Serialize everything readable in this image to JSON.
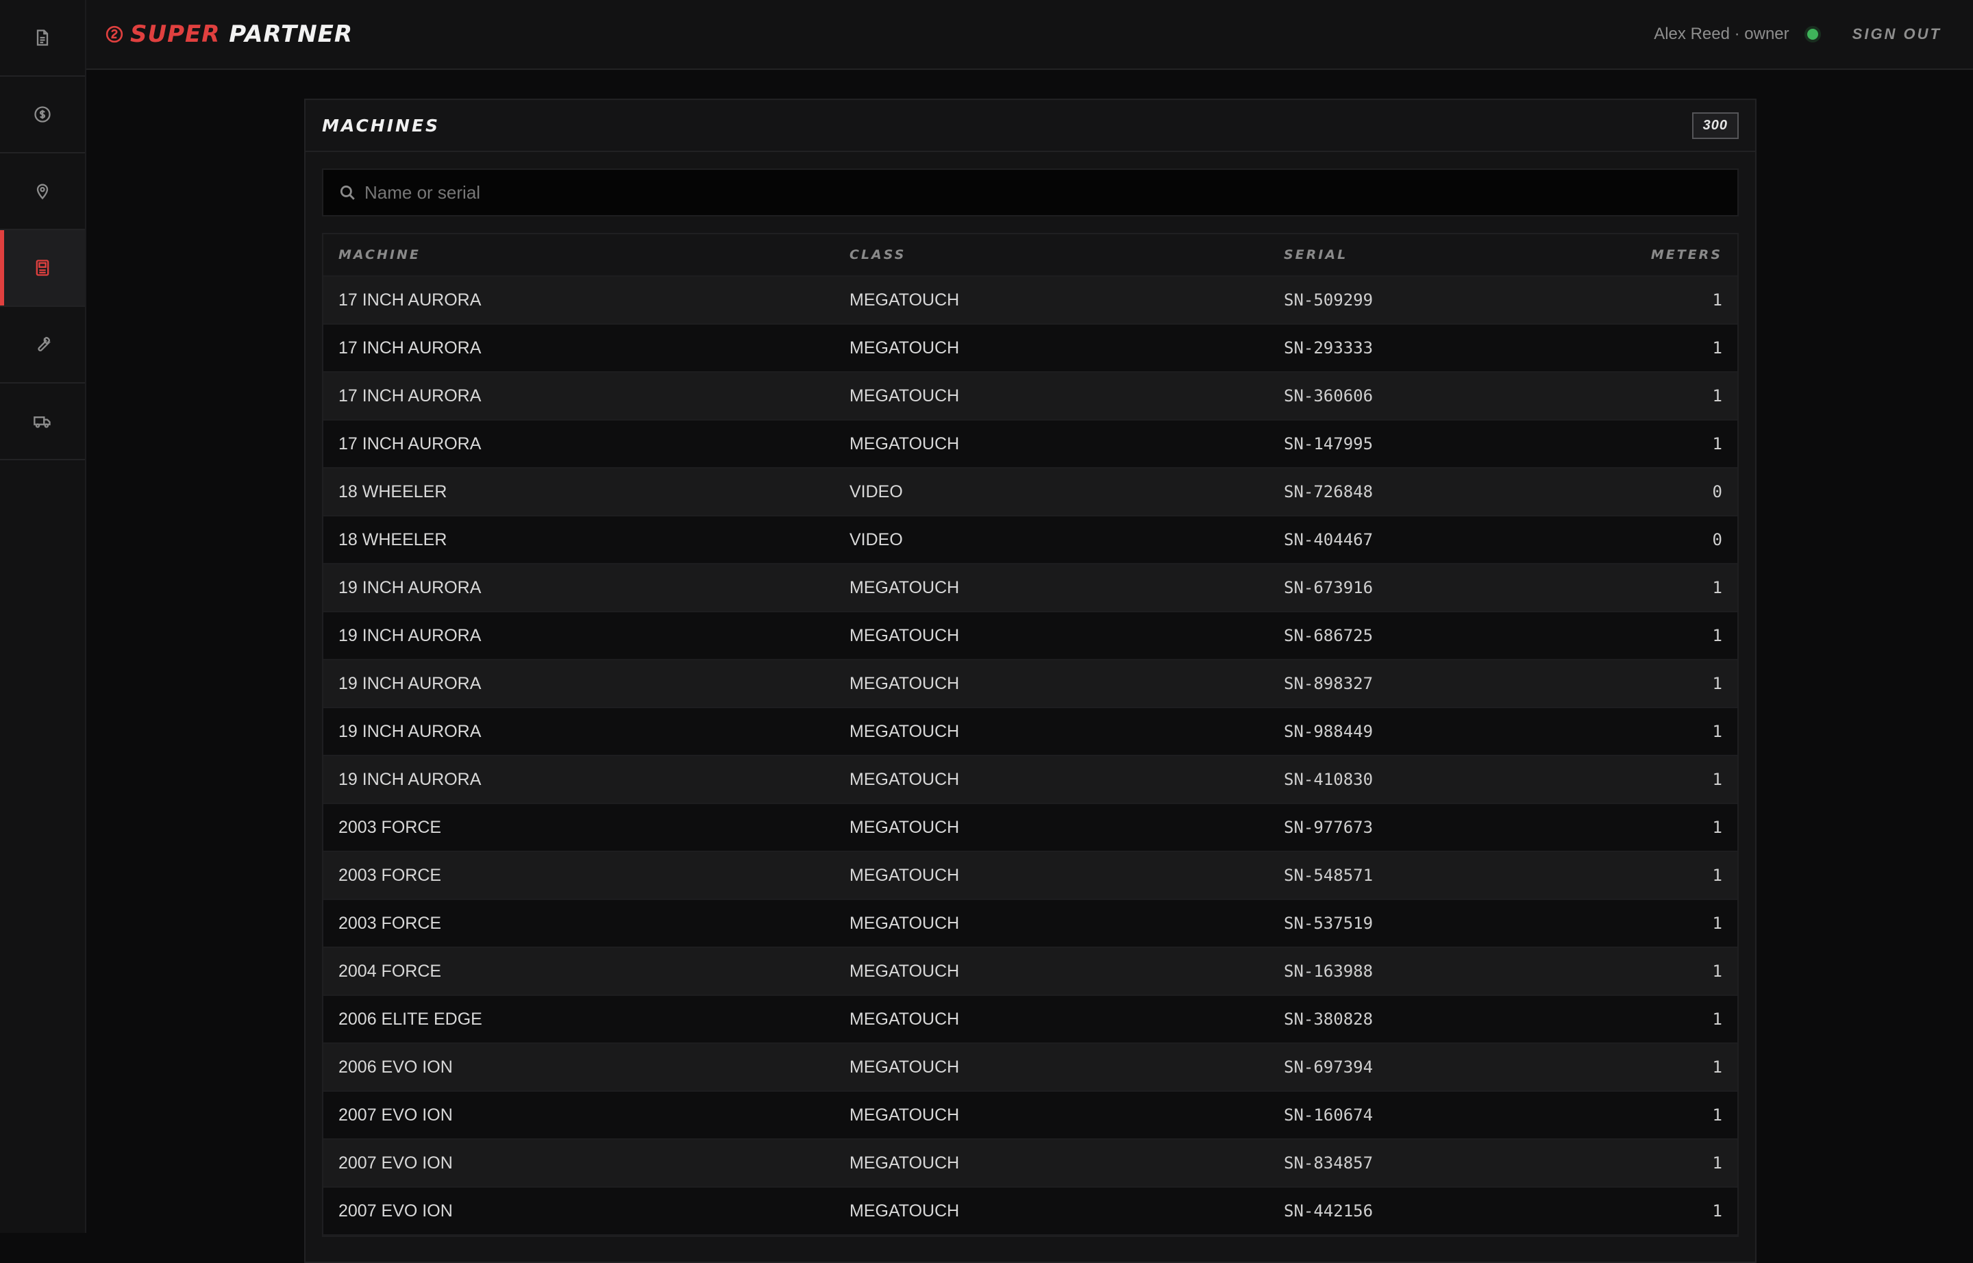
{
  "brand": {
    "super": "SUPER",
    "partner": "PARTNER"
  },
  "user": {
    "label": "Alex Reed · owner",
    "sign_out": "SIGN OUT"
  },
  "sidebar": {
    "items": [
      {
        "icon": "document-icon",
        "active": false
      },
      {
        "icon": "coin-icon",
        "active": false
      },
      {
        "icon": "location-pin-icon",
        "active": false
      },
      {
        "icon": "machine-icon",
        "active": true
      },
      {
        "icon": "wrench-icon",
        "active": false
      },
      {
        "icon": "truck-icon",
        "active": false
      }
    ]
  },
  "colors": {
    "accent": "#e0403f",
    "status": "#3fb35a"
  },
  "panel": {
    "title": "MACHINES",
    "count": "300",
    "search_placeholder": "Name or serial"
  },
  "table": {
    "columns": [
      "MACHINE",
      "CLASS",
      "SERIAL",
      "METERS"
    ],
    "rows": [
      [
        "17 INCH AURORA",
        "MEGATOUCH",
        "SN-509299",
        "1"
      ],
      [
        "17 INCH AURORA",
        "MEGATOUCH",
        "SN-293333",
        "1"
      ],
      [
        "17 INCH AURORA",
        "MEGATOUCH",
        "SN-360606",
        "1"
      ],
      [
        "17 INCH AURORA",
        "MEGATOUCH",
        "SN-147995",
        "1"
      ],
      [
        "18 WHEELER",
        "VIDEO",
        "SN-726848",
        "0"
      ],
      [
        "18 WHEELER",
        "VIDEO",
        "SN-404467",
        "0"
      ],
      [
        "19 INCH AURORA",
        "MEGATOUCH",
        "SN-673916",
        "1"
      ],
      [
        "19 INCH AURORA",
        "MEGATOUCH",
        "SN-686725",
        "1"
      ],
      [
        "19 INCH AURORA",
        "MEGATOUCH",
        "SN-898327",
        "1"
      ],
      [
        "19 INCH AURORA",
        "MEGATOUCH",
        "SN-988449",
        "1"
      ],
      [
        "19 INCH AURORA",
        "MEGATOUCH",
        "SN-410830",
        "1"
      ],
      [
        "2003 FORCE",
        "MEGATOUCH",
        "SN-977673",
        "1"
      ],
      [
        "2003 FORCE",
        "MEGATOUCH",
        "SN-548571",
        "1"
      ],
      [
        "2003 FORCE",
        "MEGATOUCH",
        "SN-537519",
        "1"
      ],
      [
        "2004 FORCE",
        "MEGATOUCH",
        "SN-163988",
        "1"
      ],
      [
        "2006 ELITE EDGE",
        "MEGATOUCH",
        "SN-380828",
        "1"
      ],
      [
        "2006 EVO ION",
        "MEGATOUCH",
        "SN-697394",
        "1"
      ],
      [
        "2007 EVO ION",
        "MEGATOUCH",
        "SN-160674",
        "1"
      ],
      [
        "2007 EVO ION",
        "MEGATOUCH",
        "SN-834857",
        "1"
      ],
      [
        "2007 EVO ION",
        "MEGATOUCH",
        "SN-442156",
        "1"
      ]
    ]
  }
}
